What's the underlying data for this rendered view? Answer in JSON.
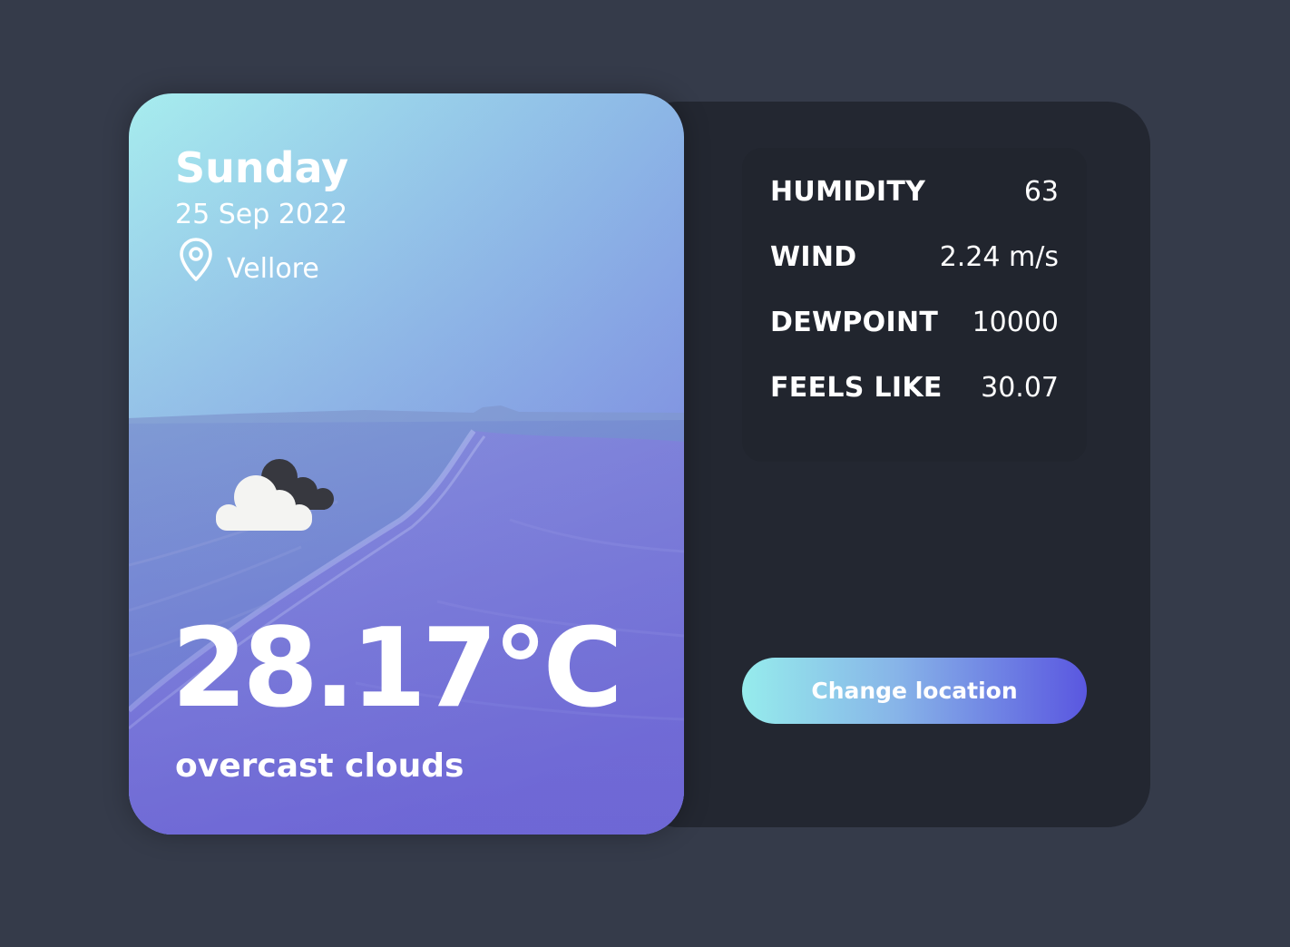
{
  "weather": {
    "day": "Sunday",
    "date": "25 Sep 2022",
    "location": "Vellore",
    "temperature": "28.17°C",
    "description": "overcast clouds",
    "icon": "cloud-icon"
  },
  "stats": [
    {
      "label": "HUMIDITY",
      "value": "63"
    },
    {
      "label": "WIND",
      "value": "2.24 m/s"
    },
    {
      "label": "DEWPOINT",
      "value": "10000"
    },
    {
      "label": "FEELS LIKE",
      "value": "30.07"
    }
  ],
  "actions": {
    "change_location_label": "Change location"
  },
  "colors": {
    "page_background": "#353b4a",
    "panel_background": "#232731",
    "button_gradient_start": "#96ecec",
    "button_gradient_end": "#5a57e0",
    "card_gradient_start": "#a7edee",
    "card_gradient_end": "#6f68d6"
  }
}
